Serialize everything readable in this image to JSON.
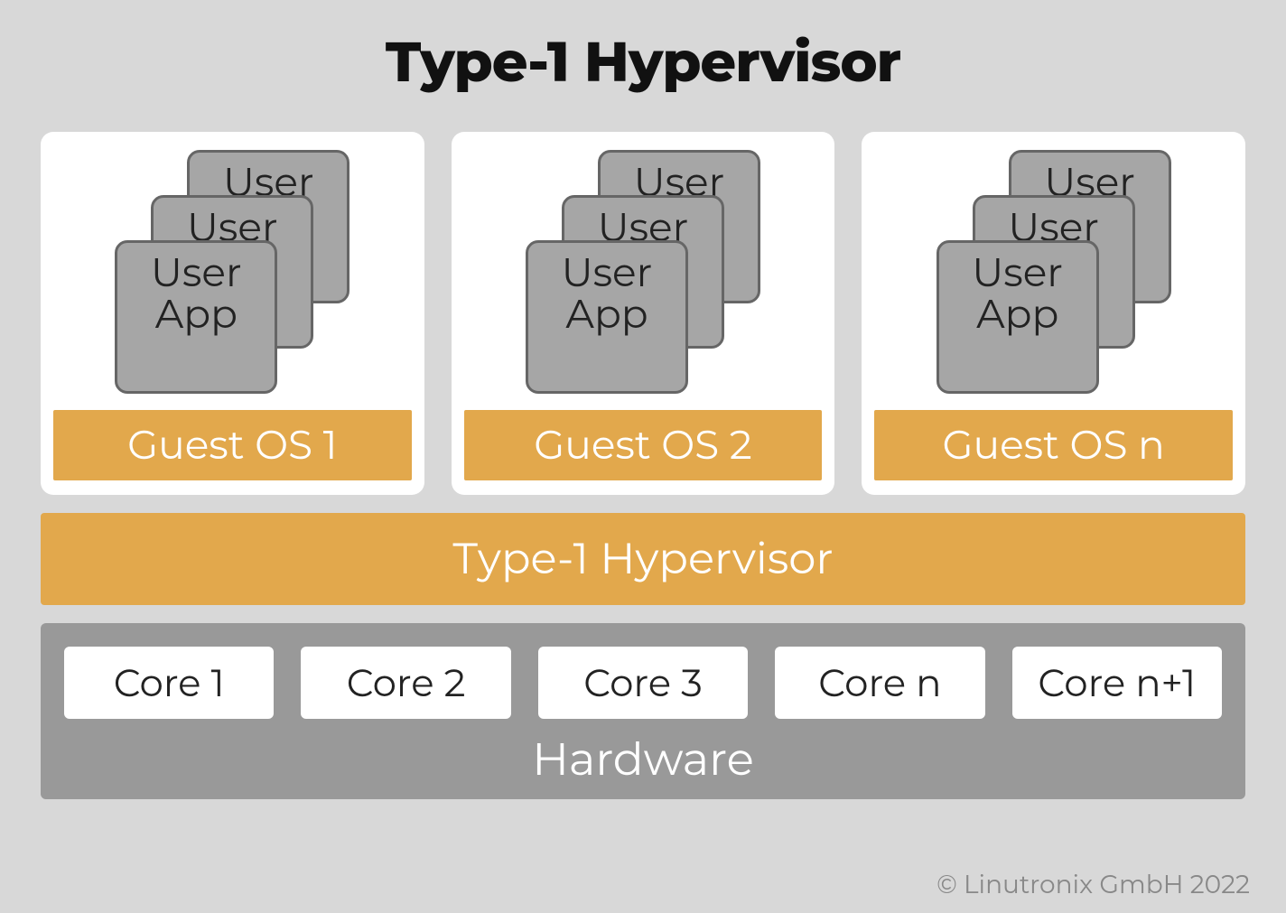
{
  "title": "Type-1 Hypervisor",
  "apps": {
    "back": {
      "line1": "User"
    },
    "mid": {
      "line1": "User"
    },
    "front": {
      "line1": "User",
      "line2": "App"
    }
  },
  "vms": [
    {
      "guest": "Guest OS 1"
    },
    {
      "guest": "Guest OS 2"
    },
    {
      "guest": "Guest OS n"
    }
  ],
  "hypervisor": "Type-1 Hypervisor",
  "cores": [
    "Core 1",
    "Core 2",
    "Core 3",
    "Core n",
    "Core n+1"
  ],
  "hardware": "Hardware",
  "credit": "© Linutronix GmbH 2022",
  "colors": {
    "accent": "#e2a84c",
    "gray": "#a6a6a6",
    "bg": "#d8d8d8"
  }
}
